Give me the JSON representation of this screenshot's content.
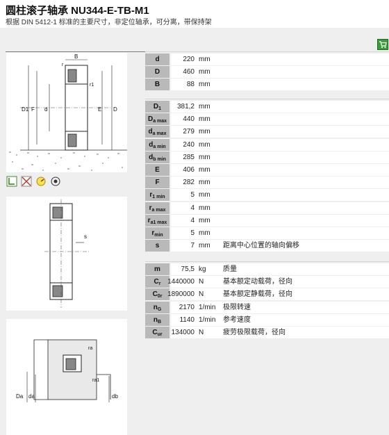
{
  "header": {
    "title": "圆柱滚子轴承 NU344-E-TB-M1",
    "subtitle": "根据 DIN 5412-1 标准的主要尺寸，非定位轴承，可分离，带保持架"
  },
  "icons": [
    "cart-icon",
    "mounting-icon",
    "no-relubrication-icon",
    "speed-icon",
    "bearing-fit-icon"
  ],
  "drawing_labels": {
    "main": {
      "r": "r",
      "r1": "r1",
      "D1": "D1",
      "F": "F",
      "d": "d",
      "E": "E",
      "D": "D",
      "B": "B"
    },
    "axial": {
      "s": "s"
    },
    "mounting": {
      "ra": "ra",
      "ra1": "ra1",
      "Da": "Da",
      "da": "da",
      "db": "db"
    }
  },
  "groups": [
    {
      "rows": [
        {
          "sym": "d",
          "sub": "",
          "value": "220",
          "unit": "mm",
          "desc": ""
        },
        {
          "sym": "D",
          "sub": "",
          "value": "460",
          "unit": "mm",
          "desc": ""
        },
        {
          "sym": "B",
          "sub": "",
          "value": "88",
          "unit": "mm",
          "desc": ""
        }
      ]
    },
    {
      "rows": [
        {
          "sym": "D",
          "sub": "1",
          "value": "381,2",
          "unit": "mm",
          "desc": ""
        },
        {
          "sym": "D",
          "sub": "a max",
          "value": "440",
          "unit": "mm",
          "desc": ""
        },
        {
          "sym": "d",
          "sub": "a max",
          "value": "279",
          "unit": "mm",
          "desc": ""
        },
        {
          "sym": "d",
          "sub": "a min",
          "value": "240",
          "unit": "mm",
          "desc": ""
        },
        {
          "sym": "d",
          "sub": "b min",
          "value": "285",
          "unit": "mm",
          "desc": ""
        },
        {
          "sym": "E",
          "sub": "",
          "value": "406",
          "unit": "mm",
          "desc": ""
        },
        {
          "sym": "F",
          "sub": "",
          "value": "282",
          "unit": "mm",
          "desc": ""
        },
        {
          "sym": "r",
          "sub": "1 min",
          "value": "5",
          "unit": "mm",
          "desc": ""
        },
        {
          "sym": "r",
          "sub": "a max",
          "value": "4",
          "unit": "mm",
          "desc": ""
        },
        {
          "sym": "r",
          "sub": "a1 max",
          "value": "4",
          "unit": "mm",
          "desc": ""
        },
        {
          "sym": "r",
          "sub": "min",
          "value": "5",
          "unit": "mm",
          "desc": ""
        },
        {
          "sym": "s",
          "sub": "",
          "value": "7",
          "unit": "mm",
          "desc": "距离中心位置的轴向偏移"
        }
      ]
    },
    {
      "rows": [
        {
          "sym": "m",
          "sub": "",
          "value": "75,5",
          "unit": "kg",
          "desc": "质量"
        },
        {
          "sym": "C",
          "sub": "r",
          "value": "1440000",
          "unit": "N",
          "desc": "基本额定动载荷，径向"
        },
        {
          "sym": "C",
          "sub": "0r",
          "value": "1890000",
          "unit": "N",
          "desc": "基本额定静载荷，径向"
        },
        {
          "sym": "n",
          "sub": "G",
          "value": "2170",
          "unit": "1/min",
          "desc": "极限转速"
        },
        {
          "sym": "n",
          "sub": "B",
          "value": "1140",
          "unit": "1/min",
          "desc": "参考速度"
        },
        {
          "sym": "C",
          "sub": "ur",
          "value": "134000",
          "unit": "N",
          "desc": "疲劳极限载荷，径向"
        }
      ]
    }
  ]
}
